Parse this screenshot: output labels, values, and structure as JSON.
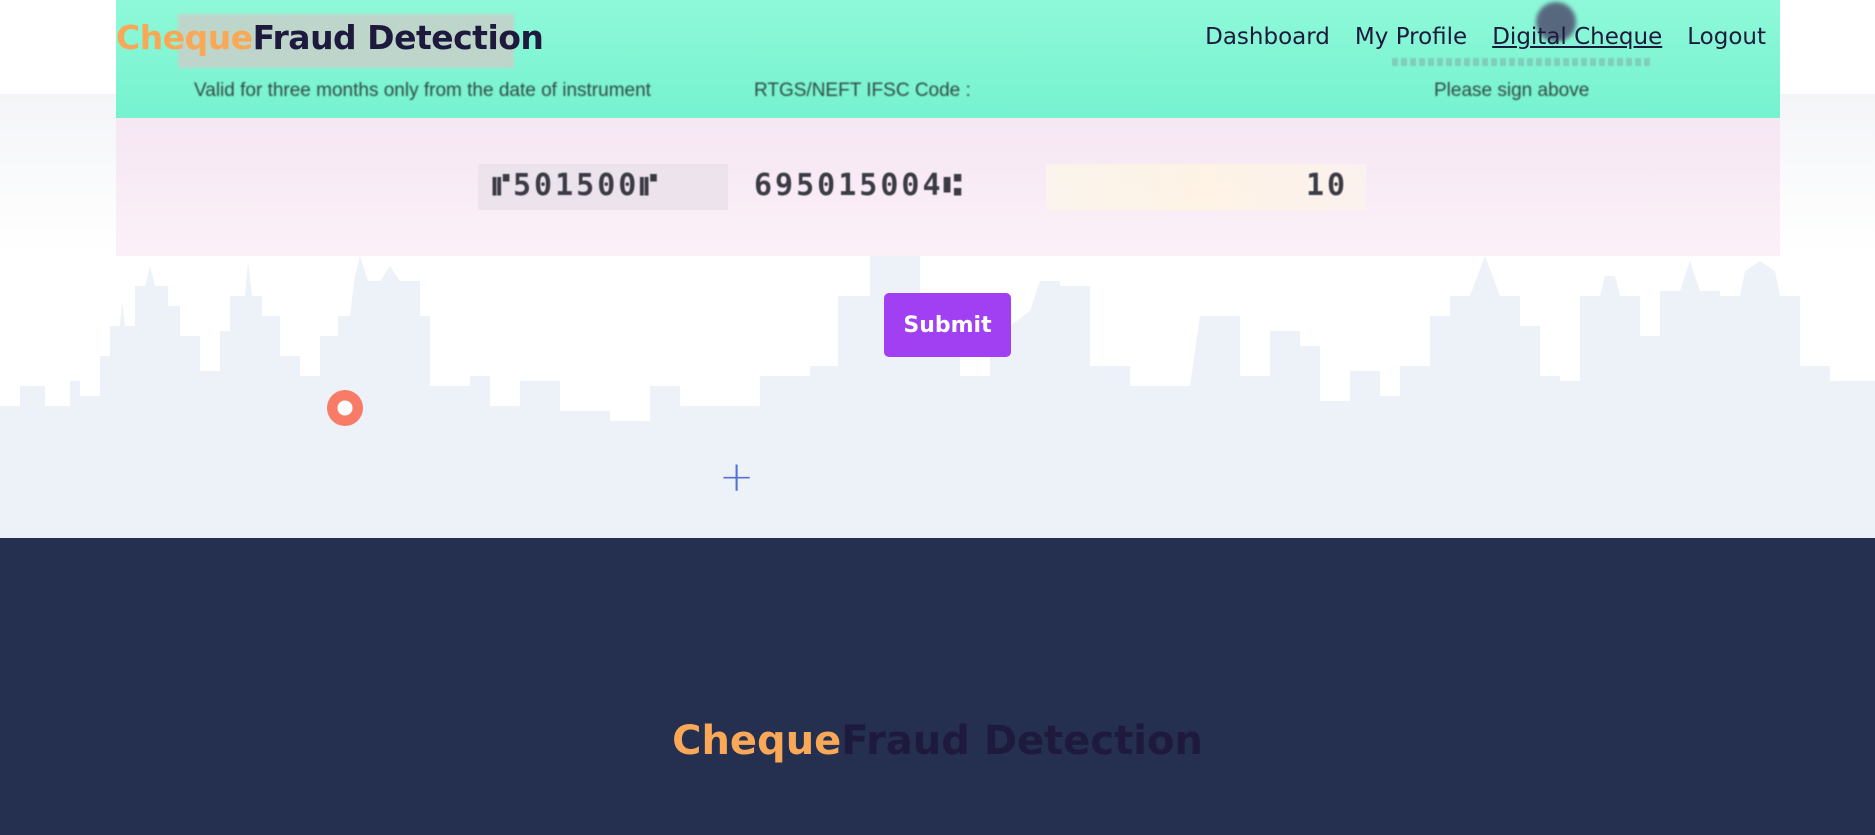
{
  "brand": {
    "part1": "Cheque",
    "part2": "Fraud Detection"
  },
  "nav": [
    {
      "label": "Dashboard"
    },
    {
      "label": "My Profile"
    },
    {
      "label": "Digital Cheque",
      "active": true
    },
    {
      "label": "Logout"
    }
  ],
  "cheque": {
    "validity_text": "Valid for three months only from the date of instrument",
    "ifsc_text": "RTGS/NEFT IFSC Code :",
    "sign_text": "Please sign above",
    "micr_cheque_no": "⑈501500⑈",
    "micr_code": "695015004⑆",
    "micr_tail": "10"
  },
  "form": {
    "submit_label": "Submit"
  },
  "footer": {
    "brand_part1": "Cheque",
    "brand_part2": "Fraud Detection"
  },
  "colors": {
    "brand_orange": "#f9a857",
    "brand_dark": "#1d1a3d",
    "submit_purple": "#a13ff2",
    "footer_bg": "#252f50",
    "skyline": "#edf1f8"
  }
}
